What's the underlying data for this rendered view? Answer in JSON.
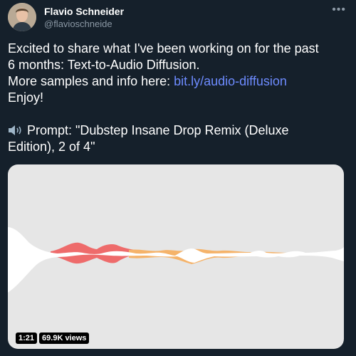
{
  "author": {
    "name": "Flavio Schneider",
    "handle": "@flavioschneide"
  },
  "tweet": {
    "line1": "Excited to share what I've been working on for the past",
    "line2": "6 months: Text-to-Audio Diffusion.",
    "line3_prefix": "More samples and info here: ",
    "link_text": "bit.ly/audio-diffusion",
    "line4": "Enjoy!",
    "prompt_line1": "Prompt: \"Dubstep Insane Drop Remix (Deluxe",
    "prompt_line2": "Edition), 2 of 4\""
  },
  "media": {
    "duration": "1:21",
    "views": "69.9K views"
  },
  "icons": {
    "more": "more-icon",
    "speaker": "speaker-icon"
  },
  "colors": {
    "background": "#15202b",
    "link": "#6d8bff",
    "waveform_red": "#ee6b6b",
    "waveform_orange": "#f5b36a"
  }
}
